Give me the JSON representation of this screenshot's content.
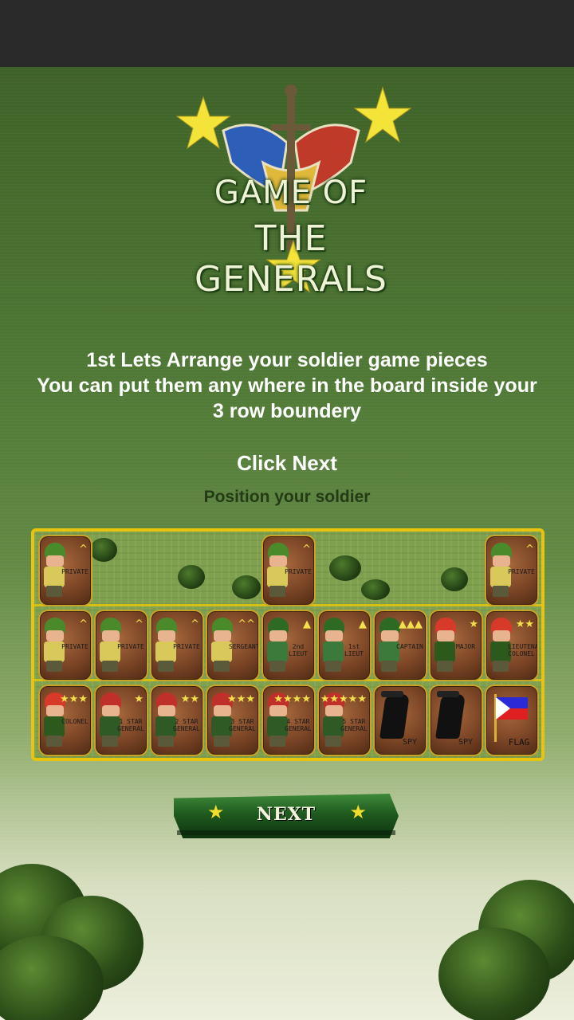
{
  "logo": {
    "line1": "GAME OF",
    "line2": "THE GENERALS"
  },
  "instructions": {
    "lines": [
      "1st Lets Arrange your soldier game pieces",
      "You can put them any where in the board inside your",
      "3 row boundery"
    ]
  },
  "click_next": "Click Next",
  "subtitle": "Position your soldier",
  "board": {
    "rows": [
      [
        {
          "type": "soldier",
          "rank": "^",
          "label": "PRIVATE"
        },
        null,
        null,
        null,
        {
          "type": "soldier",
          "rank": "^",
          "label": "PRIVATE"
        },
        null,
        null,
        null,
        {
          "type": "soldier",
          "rank": "^",
          "label": "PRIVATE"
        }
      ],
      [
        {
          "type": "soldier",
          "rank": "^",
          "label": "PRIVATE"
        },
        {
          "type": "soldier",
          "rank": "^",
          "label": "PRIVATE"
        },
        {
          "type": "soldier",
          "rank": "^",
          "label": "PRIVATE"
        },
        {
          "type": "soldier",
          "rank": "^^",
          "label": "SERGEANT"
        },
        {
          "type": "officer",
          "rank": "▲",
          "label": "2nd LIEUT"
        },
        {
          "type": "officer",
          "rank": "▲",
          "label": "1st LIEUT"
        },
        {
          "type": "officer",
          "rank": "▲▲▲",
          "label": "CAPTAIN"
        },
        {
          "type": "redhead",
          "rank": "★",
          "label": "MAJOR"
        },
        {
          "type": "redhead",
          "rank": "★★",
          "label": "LIEUTENANT COLONEL"
        }
      ],
      [
        {
          "type": "redhead",
          "rank": "★★★",
          "label": "COLONEL"
        },
        {
          "type": "general",
          "rank": "★",
          "label": "1 STAR GENERAL"
        },
        {
          "type": "general",
          "rank": "★★",
          "label": "2 STAR GENERAL"
        },
        {
          "type": "general",
          "rank": "★★★",
          "label": "3 STAR GENERAL"
        },
        {
          "type": "general",
          "rank": "★★★★",
          "label": "4 STAR GENERAL"
        },
        {
          "type": "general",
          "rank": "★★★★★",
          "label": "5 STAR GENERAL"
        },
        {
          "type": "spy",
          "rank": "",
          "label": "SPY"
        },
        {
          "type": "spy",
          "rank": "",
          "label": "SPY"
        },
        {
          "type": "flag",
          "rank": "",
          "label": "FLAG"
        }
      ]
    ]
  },
  "next_button": {
    "label": "NEXT"
  },
  "colors": {
    "board_border": "#e8c40c",
    "accent_star": "#f2dd2a",
    "background": "#4e7634"
  }
}
